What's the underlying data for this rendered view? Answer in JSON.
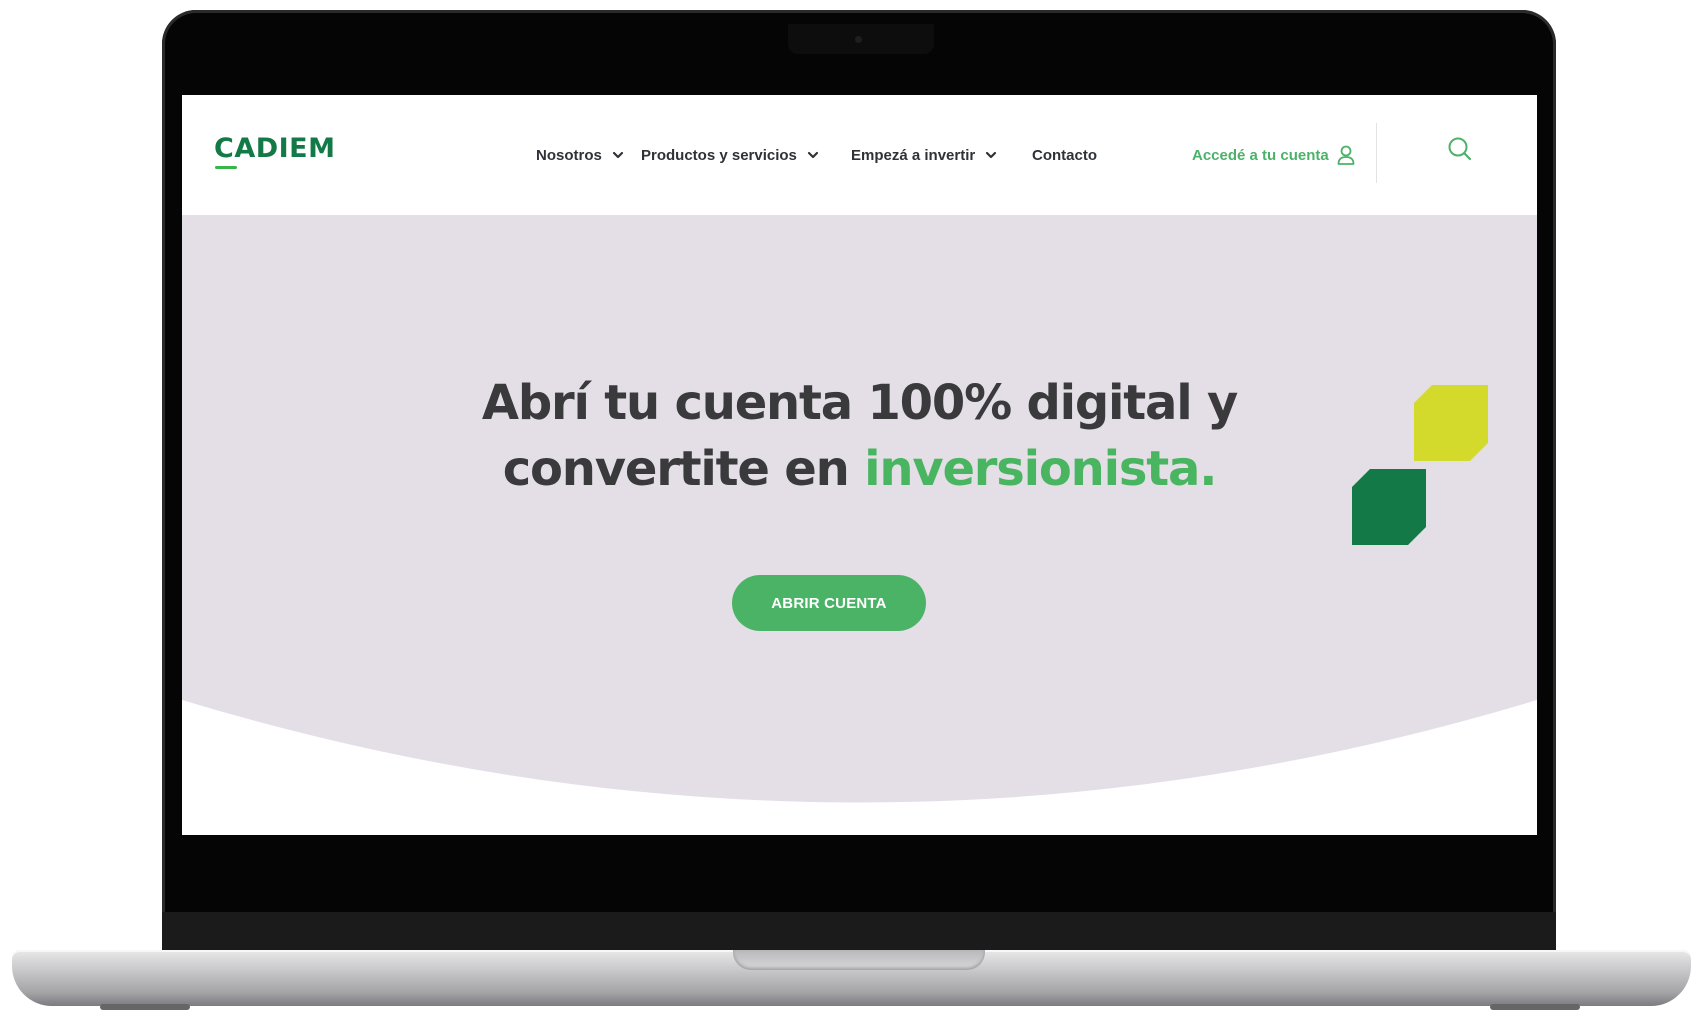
{
  "device": {
    "type": "laptop-mockup"
  },
  "header": {
    "logo": "CADIEM",
    "nav": [
      {
        "label": "Nosotros",
        "has_dropdown": true
      },
      {
        "label": "Productos y servicios",
        "has_dropdown": true
      },
      {
        "label": "Empezá a invertir",
        "has_dropdown": true
      },
      {
        "label": "Contacto",
        "has_dropdown": false
      }
    ],
    "login_label": "Accedé a tu cuenta",
    "login_icon": "user-icon",
    "search_icon": "search-icon"
  },
  "hero": {
    "title_line1": "Abrí tu cuenta 100% digital y",
    "title_line2_prefix": "convertite en ",
    "title_line2_accent": "inversionista.",
    "cta_label": "ABRIR CUENTA"
  },
  "colors": {
    "brand_green": "#137a47",
    "accent_green": "#4bb366",
    "accent_yellow": "#d3da2b",
    "hero_background": "#e4dfe6",
    "text_dark": "#3a3a3d"
  }
}
